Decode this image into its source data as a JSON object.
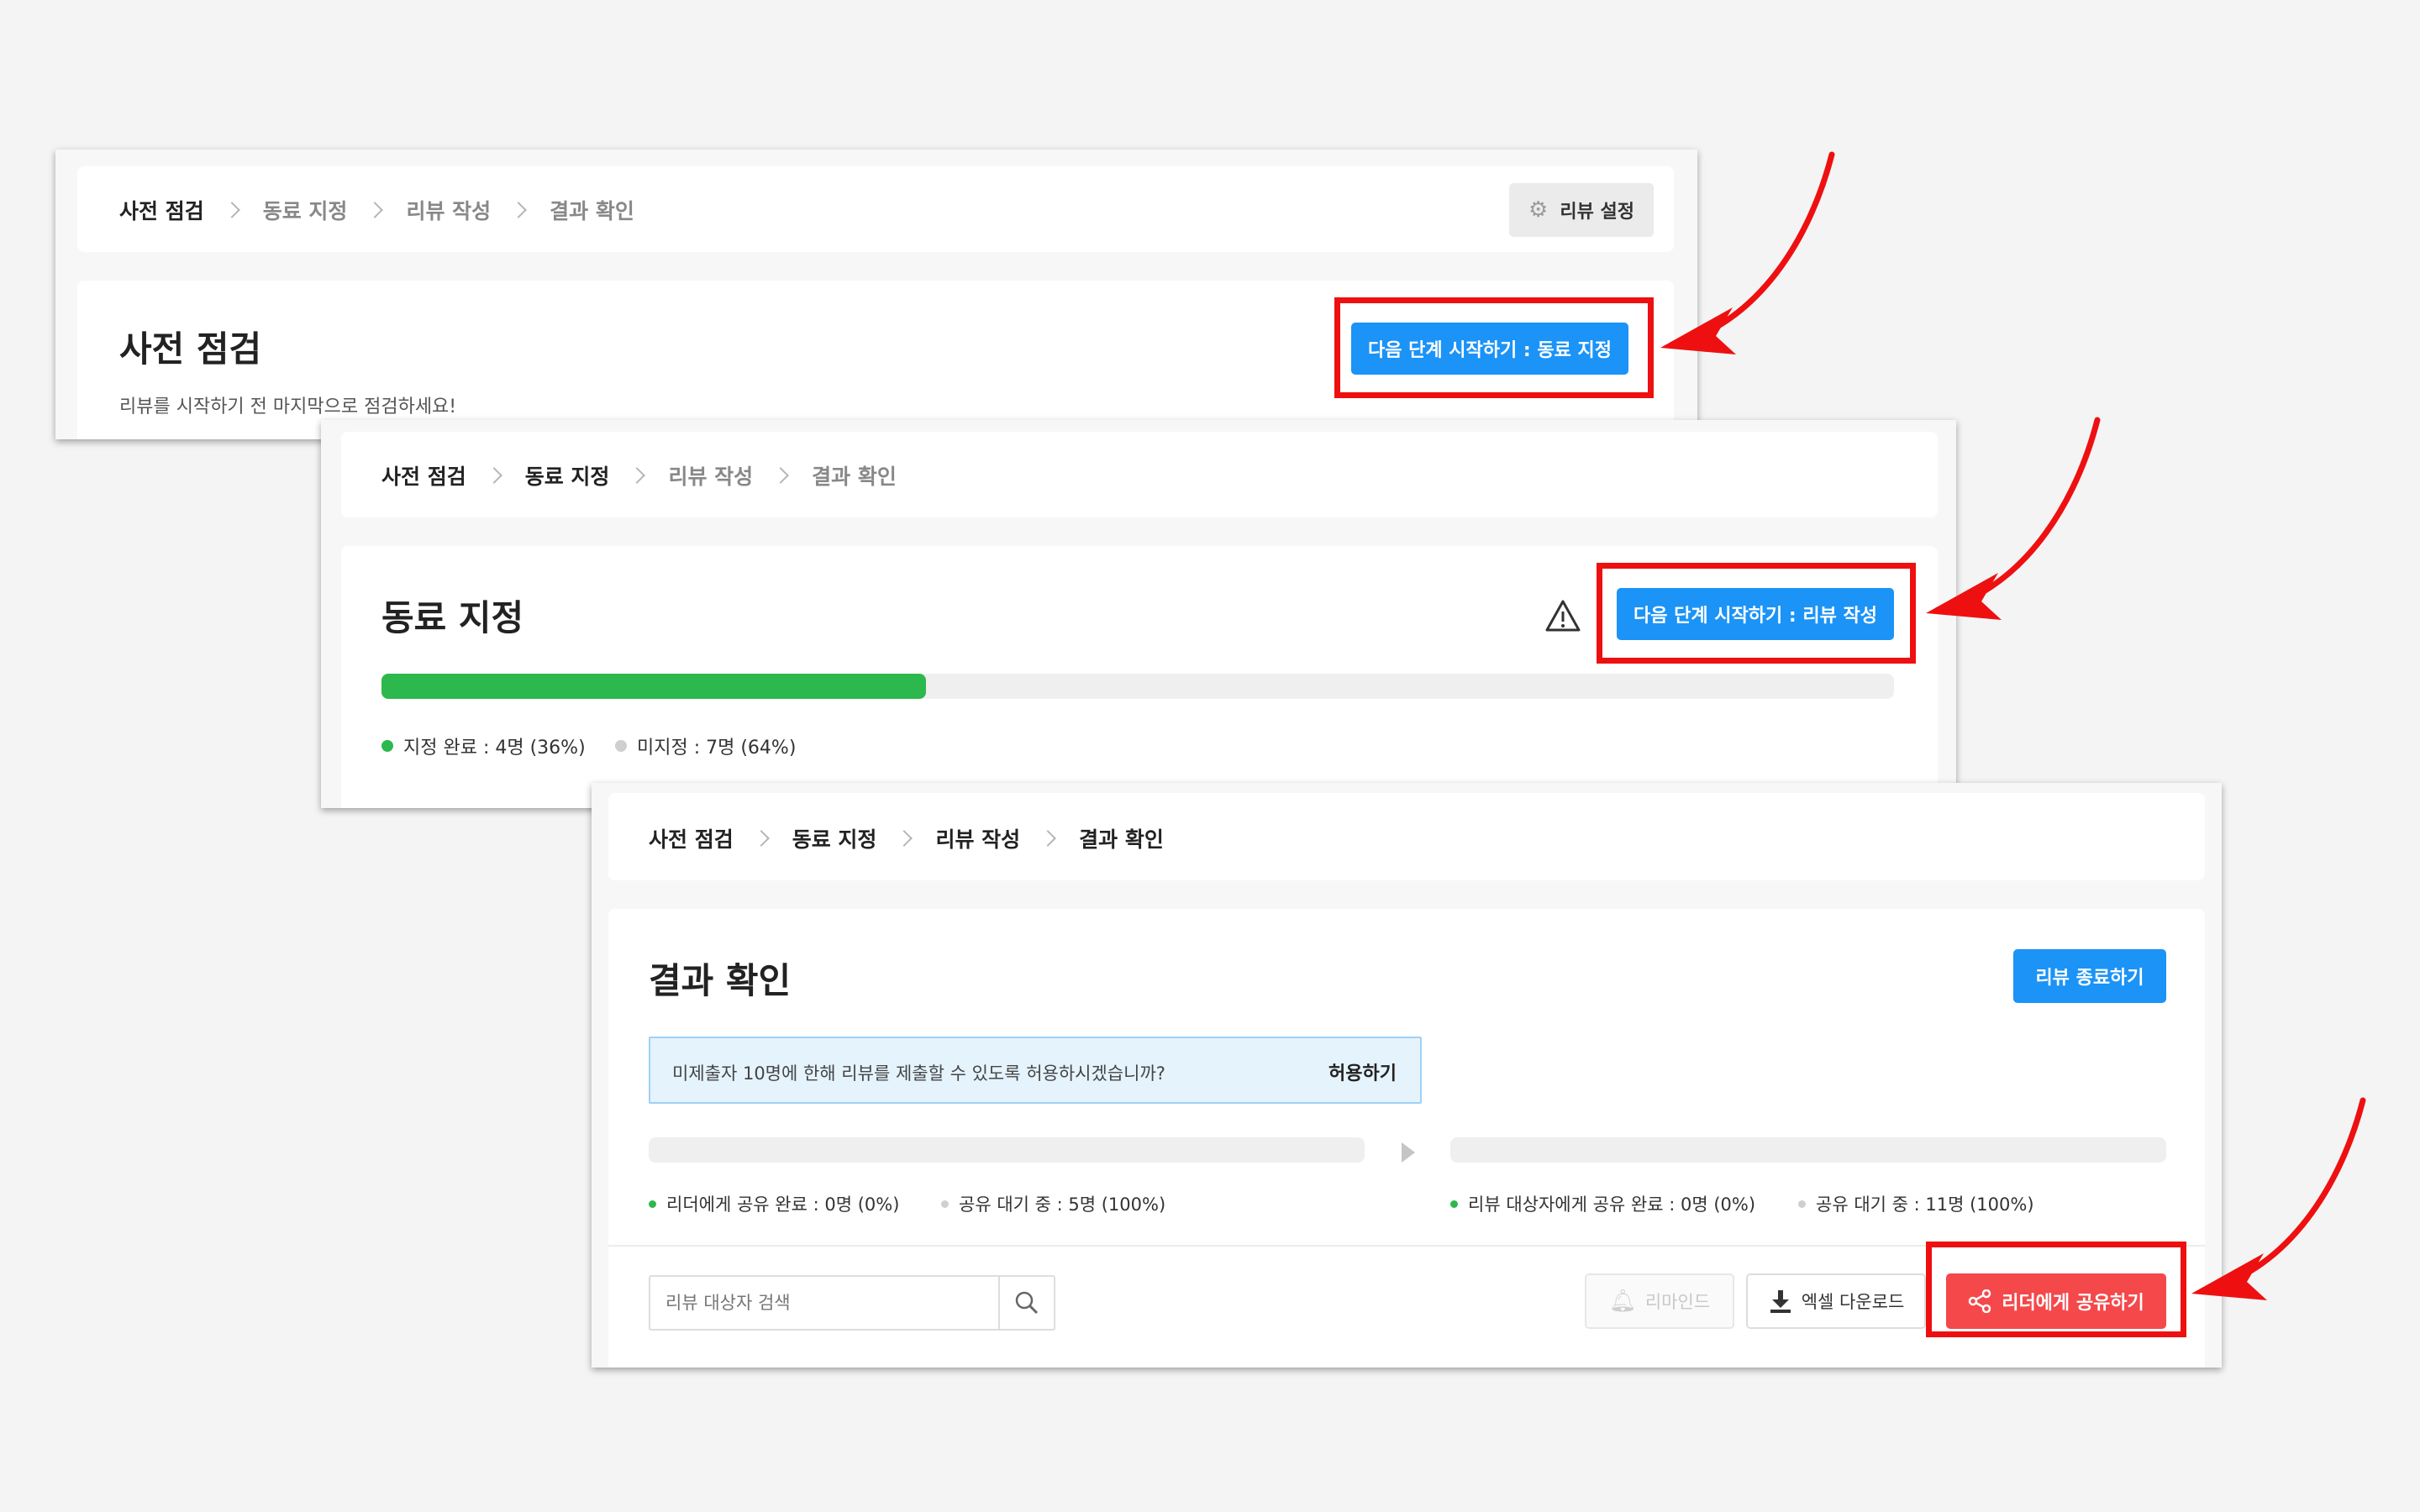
{
  "steps": [
    "사전 점검",
    "동료 지정",
    "리뷰 작성",
    "결과 확인"
  ],
  "panel1": {
    "settings_label": "리뷰 설정",
    "title": "사전 점검",
    "subtitle": "리뷰를 시작하기 전 마지막으로 점검하세요!",
    "next_button": "다음 단계 시작하기 : 동료 지정"
  },
  "panel2": {
    "title": "동료 지정",
    "next_button": "다음 단계 시작하기 : 리뷰 작성",
    "progress": 0.36,
    "assigned_label": "지정 완료 : 4명 (36%)",
    "unassigned_label": "미지정 : 7명 (64%)"
  },
  "panel3": {
    "title": "결과 확인",
    "end_button": "리뷰 종료하기",
    "notice_text": "미제출자 10명에 한해 리뷰를 제출할 수 있도록 허용하시겠습니까?",
    "notice_action": "허용하기",
    "left_done": "리더에게 공유 완료 : 0명 (0%)",
    "left_wait": "공유 대기 중 : 5명 (100%)",
    "right_done": "리뷰 대상자에게 공유 완료 : 0명 (0%)",
    "right_wait": "공유 대기 중 : 11명 (100%)",
    "search_placeholder": "리뷰 대상자 검색",
    "remind_button": "리마인드",
    "excel_button": "엑셀 다운로드",
    "share_button": "리더에게 공유하기"
  },
  "colors": {
    "accent_blue": "#1b93f7",
    "share_red": "#f5484a",
    "progress_green": "#2db84d",
    "highlight_red": "#ee1010"
  }
}
